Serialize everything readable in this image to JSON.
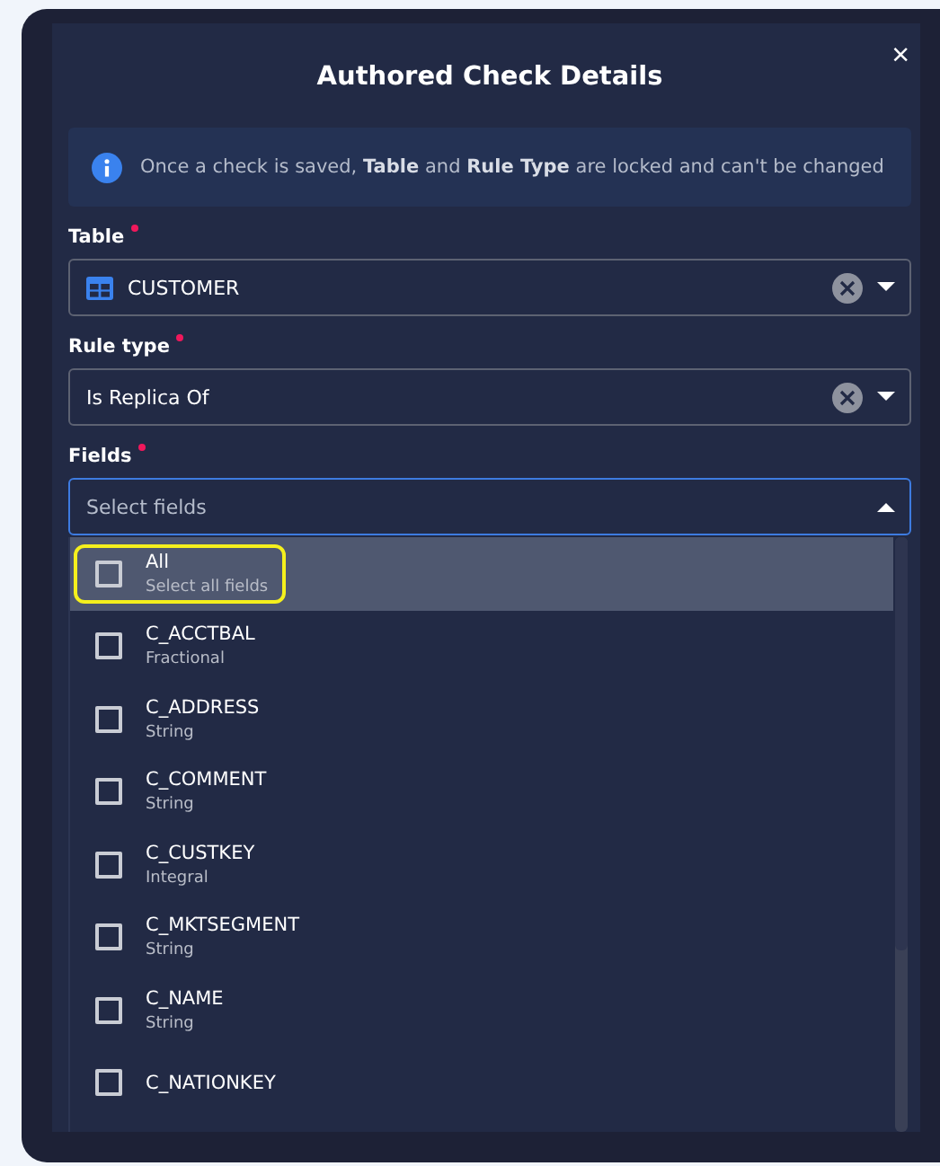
{
  "dialog": {
    "title": "Authored Check Details",
    "close": "×"
  },
  "info": {
    "text": "Once a check is saved, **Table** and **Rule Type** are locked and can't be changed"
  },
  "form": [
    {
      "kind": "table",
      "label": "Table",
      "required": true,
      "value": "CUSTOMER",
      "clearable": true
    },
    {
      "kind": "plain",
      "label": "Rule type",
      "required": true,
      "value": "Is Replica Of",
      "clearable": true
    },
    {
      "kind": "multi",
      "label": "Fields",
      "required": true,
      "placeholder": "Select fields",
      "expanded": true,
      "focused": true
    }
  ],
  "options": [
    {
      "name": "All",
      "type": "Select all fields",
      "checked": false,
      "highlighted": true
    },
    {
      "name": "C_ACCTBAL",
      "type": "Fractional",
      "checked": false,
      "highlighted": false
    },
    {
      "name": "C_ADDRESS",
      "type": "String",
      "checked": false,
      "highlighted": false
    },
    {
      "name": "C_COMMENT",
      "type": "String",
      "checked": false,
      "highlighted": false
    },
    {
      "name": "C_CUSTKEY",
      "type": "Integral",
      "checked": false,
      "highlighted": false
    },
    {
      "name": "C_MKTSEGMENT",
      "type": "String",
      "checked": false,
      "highlighted": false
    },
    {
      "name": "C_NAME",
      "type": "String",
      "checked": false,
      "highlighted": false
    },
    {
      "name": "C_NATIONKEY",
      "checked": false,
      "highlighted": false
    }
  ]
}
